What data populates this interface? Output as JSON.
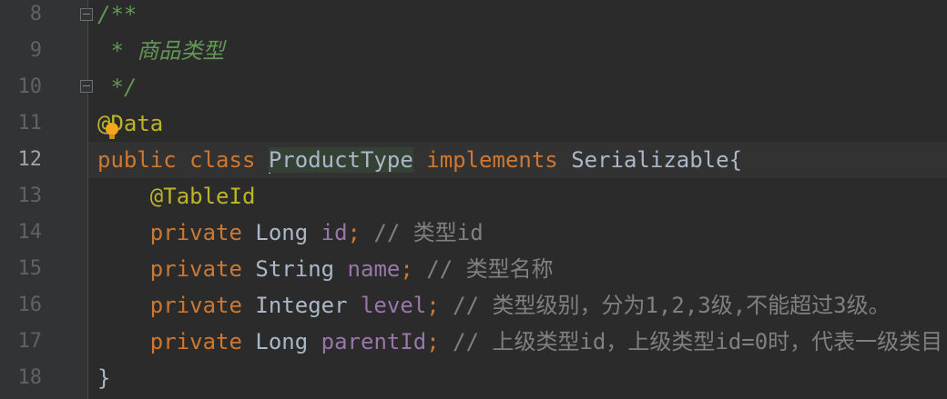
{
  "editor": {
    "current_line": 12,
    "lines": [
      {
        "num": "8",
        "tokens": [
          {
            "t": "/**",
            "c": "doc"
          }
        ]
      },
      {
        "num": "9",
        "tokens": [
          {
            "t": " * 商品类型",
            "c": "doc"
          }
        ]
      },
      {
        "num": "10",
        "tokens": [
          {
            "t": " */",
            "c": "doc"
          }
        ]
      },
      {
        "num": "11",
        "tokens": [
          {
            "t": "@Data",
            "c": "ann"
          }
        ]
      },
      {
        "num": "12",
        "tokens": [
          {
            "t": "public class ",
            "c": "kw"
          },
          {
            "t": "ProductType",
            "c": "plain hl",
            "caret": true
          },
          {
            "t": " implements ",
            "c": "kw"
          },
          {
            "t": "Serializable{",
            "c": "plain"
          }
        ]
      },
      {
        "num": "13",
        "tokens": [
          {
            "t": "    ",
            "c": "plain"
          },
          {
            "t": "@TableId",
            "c": "ann"
          }
        ]
      },
      {
        "num": "14",
        "tokens": [
          {
            "t": "    private ",
            "c": "kw"
          },
          {
            "t": "Long ",
            "c": "plain"
          },
          {
            "t": "id",
            "c": "field"
          },
          {
            "t": "; ",
            "c": "kw"
          },
          {
            "t": "// 类型id",
            "c": "comment"
          }
        ]
      },
      {
        "num": "15",
        "tokens": [
          {
            "t": "    private ",
            "c": "kw"
          },
          {
            "t": "String ",
            "c": "plain"
          },
          {
            "t": "name",
            "c": "field"
          },
          {
            "t": "; ",
            "c": "kw"
          },
          {
            "t": "// 类型名称",
            "c": "comment"
          }
        ]
      },
      {
        "num": "16",
        "tokens": [
          {
            "t": "    private ",
            "c": "kw"
          },
          {
            "t": "Integer ",
            "c": "plain"
          },
          {
            "t": "level",
            "c": "field"
          },
          {
            "t": "; ",
            "c": "kw"
          },
          {
            "t": "// 类型级别，分为1,2,3级,不能超过3级。",
            "c": "comment"
          }
        ]
      },
      {
        "num": "17",
        "tokens": [
          {
            "t": "    private ",
            "c": "kw"
          },
          {
            "t": "Long ",
            "c": "plain"
          },
          {
            "t": "parentId",
            "c": "field"
          },
          {
            "t": "; ",
            "c": "kw"
          },
          {
            "t": "// 上级类型id，上级类型id=0时，代表一级类目",
            "c": "comment"
          }
        ]
      },
      {
        "num": "18",
        "tokens": [
          {
            "t": "}",
            "c": "plain"
          }
        ]
      }
    ]
  },
  "icons": {
    "fold_open": "fold-open-icon",
    "fold_close": "fold-close-icon",
    "intention": "intention-bulb-icon"
  },
  "colors": {
    "background": "#2b2b2b",
    "gutter": "#313335",
    "keyword": "#cc7832",
    "annotation": "#bbb529",
    "doc_comment": "#629755",
    "field": "#9876aa",
    "comment": "#808080",
    "text": "#a9b7c6",
    "line_number": "#606366"
  }
}
